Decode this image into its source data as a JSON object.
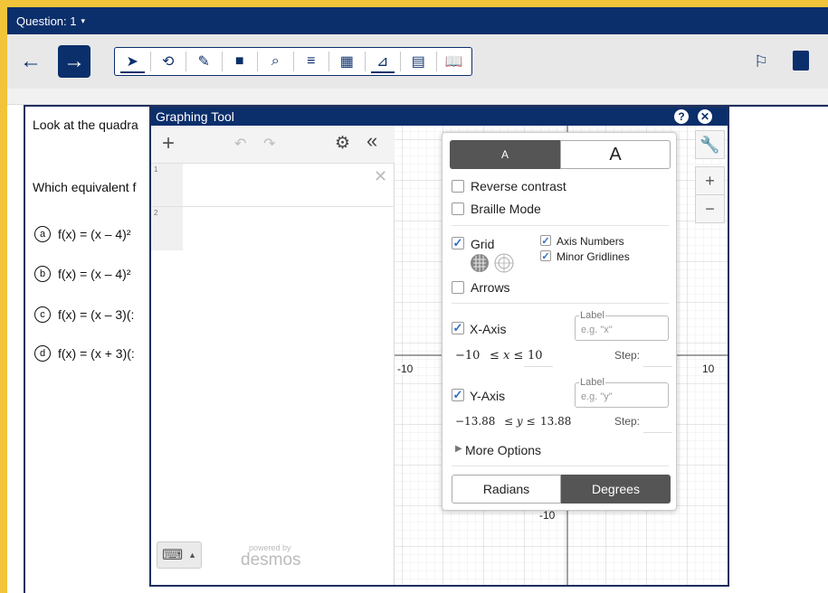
{
  "header": {
    "question_label": "Question: 1",
    "caret": "▾"
  },
  "toolbar": {
    "back_icon": "←",
    "forward_icon": "→",
    "tools": [
      {
        "name": "pointer-tool",
        "glyph": "➤",
        "active": true
      },
      {
        "name": "line-reader-tool",
        "glyph": "⟲",
        "active": false
      },
      {
        "name": "highlighter-tool",
        "glyph": "✎",
        "active": false
      },
      {
        "name": "sticky-note-tool",
        "glyph": "■",
        "active": false
      },
      {
        "name": "zoom-tool",
        "glyph": "⌕",
        "active": false
      },
      {
        "name": "text-to-speech-tool",
        "glyph": "≡",
        "active": false
      },
      {
        "name": "calculator-tool",
        "glyph": "▦",
        "active": false
      },
      {
        "name": "graphing-tool",
        "glyph": "⊿",
        "active": true
      },
      {
        "name": "notepad-tool",
        "glyph": "▤",
        "active": false
      },
      {
        "name": "reference-tool",
        "glyph": "📖",
        "active": false
      }
    ],
    "flag_icon": "⚐"
  },
  "question": {
    "stem_partial": "Look at the quadra",
    "prompt_partial": "Which equivalent f",
    "options": [
      {
        "letter": "a",
        "text": "f(x) = (x – 4)²"
      },
      {
        "letter": "b",
        "text": "f(x) = (x – 4)²"
      },
      {
        "letter": "c",
        "text": "f(x) = (x – 3)(:"
      },
      {
        "letter": "d",
        "text": "f(x) = (x + 3)(:"
      }
    ]
  },
  "graphing_tool": {
    "title": "Graphing Tool",
    "help_icon": "?",
    "close_icon": "✕",
    "add_icon": "+",
    "undo_icon": "↶",
    "redo_icon": "↷",
    "gear_icon": "⚙",
    "collapse_icon": "«",
    "expression_rows": [
      "1",
      "2"
    ],
    "delete_icon": "✕",
    "keyboard_icon": "⌨",
    "keyboard_caret": "▲",
    "powered_by": "powered by",
    "brand": "desmos",
    "axis_labels": {
      "x_min": "-10",
      "x_max": "10",
      "y_min": "-10"
    }
  },
  "settings": {
    "font_small": "A",
    "font_large": "A",
    "reverse_contrast": "Reverse contrast",
    "braille_mode": "Braille Mode",
    "grid": "Grid",
    "axis_numbers": "Axis Numbers",
    "minor_gridlines": "Minor Gridlines",
    "arrows": "Arrows",
    "x_axis": "X-Axis",
    "x_label_legend": "Label",
    "x_label_placeholder": "e.g. \"x\"",
    "x_min": "−10",
    "x_relation": "≤ x ≤",
    "x_max": "10",
    "step": "Step:",
    "y_axis": "Y-Axis",
    "y_label_legend": "Label",
    "y_label_placeholder": "e.g. \"y\"",
    "y_min": "−13.88",
    "y_relation": "≤ y ≤",
    "y_max": "13.88",
    "more_options": "More Options",
    "radians": "Radians",
    "degrees": "Degrees",
    "checked": {
      "reverse_contrast": false,
      "braille_mode": false,
      "grid": true,
      "axis_numbers": true,
      "minor_gridlines": true,
      "arrows": false,
      "x_axis": true,
      "y_axis": true
    },
    "wrench_icon": "🔧",
    "zoom_in": "+",
    "zoom_out": "−"
  },
  "colors": {
    "navy": "#0b2f6b",
    "frame": "#f2c43a",
    "check": "#2d6ec6",
    "segment_dark": "#555555"
  }
}
